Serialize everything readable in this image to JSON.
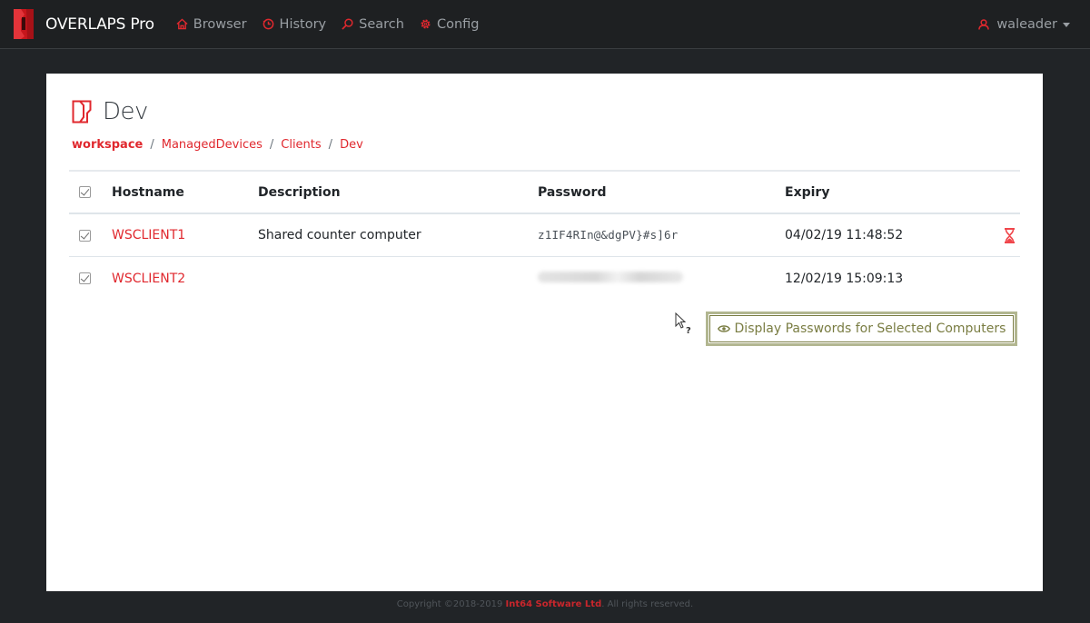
{
  "app": {
    "name": "OVERLAPS Pro",
    "brand_color": "#e0282e"
  },
  "nav": {
    "items": [
      {
        "label": "Browser",
        "icon": "home-icon"
      },
      {
        "label": "History",
        "icon": "history-icon"
      },
      {
        "label": "Search",
        "icon": "search-icon"
      },
      {
        "label": "Config",
        "icon": "gear-icon"
      }
    ],
    "user": {
      "name": "waleader",
      "icon": "user-icon"
    }
  },
  "page": {
    "title": "Dev",
    "title_icon": "ou-folder-icon",
    "breadcrumb": [
      "workspace",
      "ManagedDevices",
      "Clients",
      "Dev"
    ],
    "breadcrumb_separator": "/"
  },
  "table": {
    "columns": [
      "Hostname",
      "Description",
      "Password",
      "Expiry"
    ],
    "rows": [
      {
        "selected": true,
        "hostname": "WSCLIENT1",
        "description": "Shared counter computer",
        "password": "z1IF4RIn@&dgPV}#s]6r",
        "password_visible": true,
        "expiry": "04/02/19 11:48:52",
        "status_icon": "hourglass-expired-icon"
      },
      {
        "selected": true,
        "hostname": "WSCLIENT2",
        "description": "",
        "password": "",
        "password_visible": false,
        "expiry": "12/02/19 15:09:13",
        "status_icon": ""
      }
    ],
    "select_all": true
  },
  "actions": {
    "display_passwords_label": "Display Passwords for Selected Computers",
    "display_passwords_icon": "eye-icon",
    "accent_color": "#7a7d43"
  },
  "footer": {
    "prefix": "Copyright ©2018-2019 ",
    "company": "Int64 Software Ltd",
    "suffix": ". All rights reserved."
  }
}
